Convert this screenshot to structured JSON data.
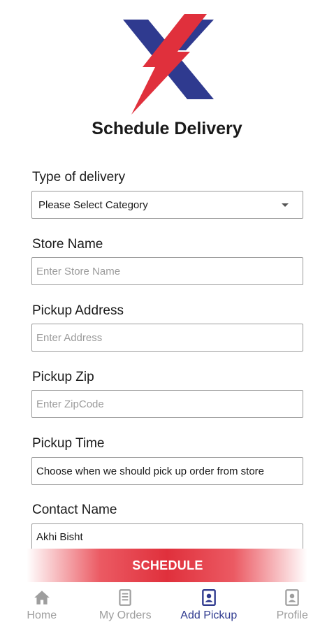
{
  "header": {
    "title": "Schedule Delivery"
  },
  "form": {
    "type_of_delivery": {
      "label": "Type of delivery",
      "selected": "Please Select Category"
    },
    "store_name": {
      "label": "Store Name",
      "placeholder": "Enter Store Name"
    },
    "pickup_address": {
      "label": "Pickup Address",
      "placeholder": "Enter Address"
    },
    "pickup_zip": {
      "label": "Pickup Zip",
      "placeholder": "Enter ZipCode"
    },
    "pickup_time": {
      "label": "Pickup Time",
      "value": "Choose when we should pick up order from store"
    },
    "contact_name": {
      "label": "Contact Name",
      "value": "Akhi Bisht"
    }
  },
  "actions": {
    "schedule_label": "SCHEDULE"
  },
  "bottom_nav": {
    "items": [
      {
        "label": "Home",
        "icon": "home-icon",
        "active": false
      },
      {
        "label": "My Orders",
        "icon": "orders-icon",
        "active": false
      },
      {
        "label": "Add Pickup",
        "icon": "add-pickup-icon",
        "active": true
      },
      {
        "label": "Profile",
        "icon": "profile-icon",
        "active": false
      }
    ]
  },
  "colors": {
    "brand_navy": "#2f3a8f",
    "brand_red": "#e0303c",
    "inactive_gray": "#9e9e9e"
  }
}
